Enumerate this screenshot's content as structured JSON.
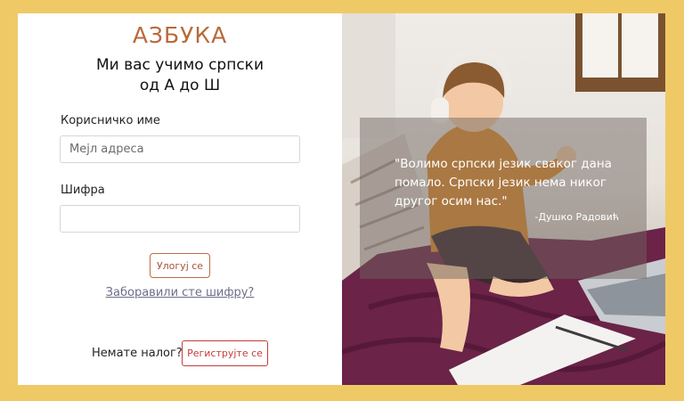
{
  "brand": "АЗБУКА",
  "tagline_line1": "Ми вас учимо српски",
  "tagline_line2": "од А до Ш",
  "login_form": {
    "username_label": "Корисничко име",
    "username_placeholder": "Мејл адреса",
    "password_label": "Шифра",
    "login_button": "Улогуј се",
    "forgot_link": "Заборавили сте шифру?"
  },
  "register": {
    "prompt": "Немате налог?",
    "button": "Региструјте се"
  },
  "quote": {
    "text": "\"Волимо српски језик сваког дана помало. Српски језик нема никог другог осим нас.\"",
    "author": "-Душко Радовић"
  },
  "colors": {
    "page_background": "#f0c967",
    "brand": "#b86a3b",
    "bedsheet": "#6b2348"
  }
}
